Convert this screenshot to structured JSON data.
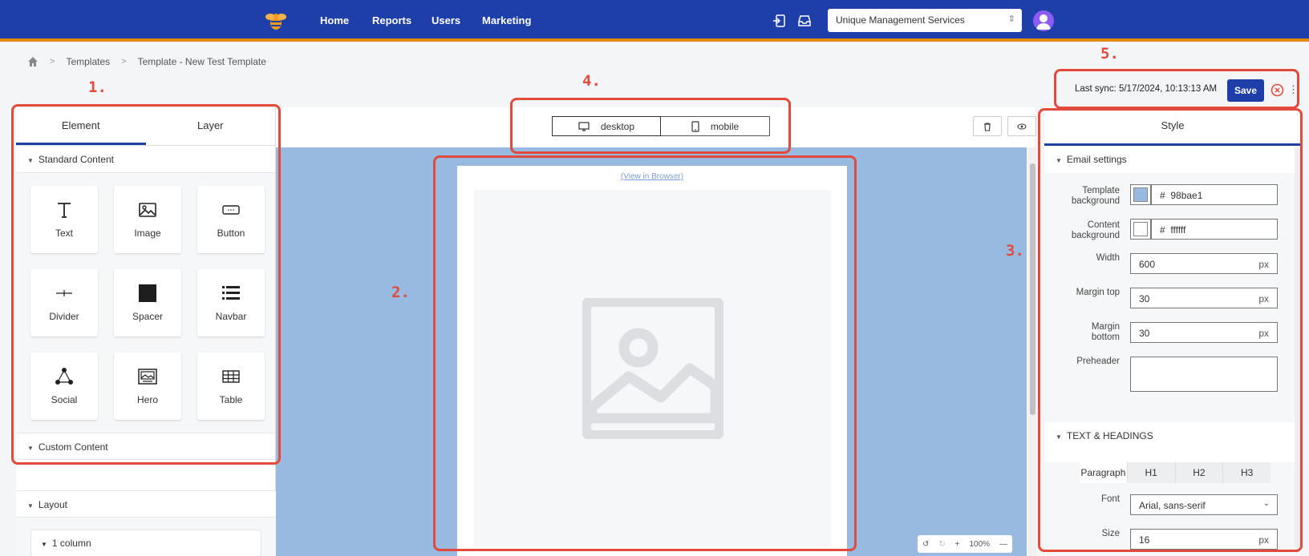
{
  "nav": {
    "items": [
      "Home",
      "Reports",
      "Users",
      "Marketing"
    ],
    "organization": "Unique Management Services"
  },
  "breadcrumb": {
    "items": [
      "Templates",
      "Template - New Test Template"
    ]
  },
  "annotations": [
    "1.",
    "2.",
    "3.",
    "4.",
    "5."
  ],
  "left_panel": {
    "tabs": [
      "Element",
      "Layer"
    ],
    "standard_content": "Standard Content",
    "elements": [
      "Text",
      "Image",
      "Button",
      "Divider",
      "Spacer",
      "Navbar",
      "Social",
      "Hero",
      "Table"
    ],
    "custom_content": "Custom Content",
    "layout": "Layout",
    "layout_item": "1 column"
  },
  "canvas": {
    "devices": [
      "desktop",
      "mobile"
    ],
    "view_in_browser": "(View in Browser)",
    "zoom": "100%",
    "background_color": "#98bae1"
  },
  "sync": {
    "text": "Last sync: 5/17/2024, 10:13:13 AM",
    "save_label": "Save"
  },
  "right_panel": {
    "tab": "Style",
    "email_settings": "Email settings",
    "template_bg_label_1": "Template",
    "template_bg_label_2": "background",
    "template_bg": "98bae1",
    "content_bg_label_1": "Content",
    "content_bg_label_2": "background",
    "content_bg": "ffffff",
    "hash": "#",
    "width_label": "Width",
    "width": "600",
    "margin_top_label": "Margin top",
    "margin_top": "30",
    "margin_bottom_label_1": "Margin",
    "margin_bottom_label_2": "bottom",
    "margin_bottom": "30",
    "preheader_label": "Preheader",
    "unit": "px",
    "text_headings": "TEXT & HEADINGS",
    "text_tabs": [
      "Paragraph",
      "H1",
      "H2",
      "H3"
    ],
    "font_label": "Font",
    "font": "Arial, sans-serif",
    "size_label": "Size",
    "size": "16"
  },
  "colors": {
    "brand": "#1f3fa8",
    "accent": "#e38a12",
    "annotation": "#e24b3b"
  }
}
